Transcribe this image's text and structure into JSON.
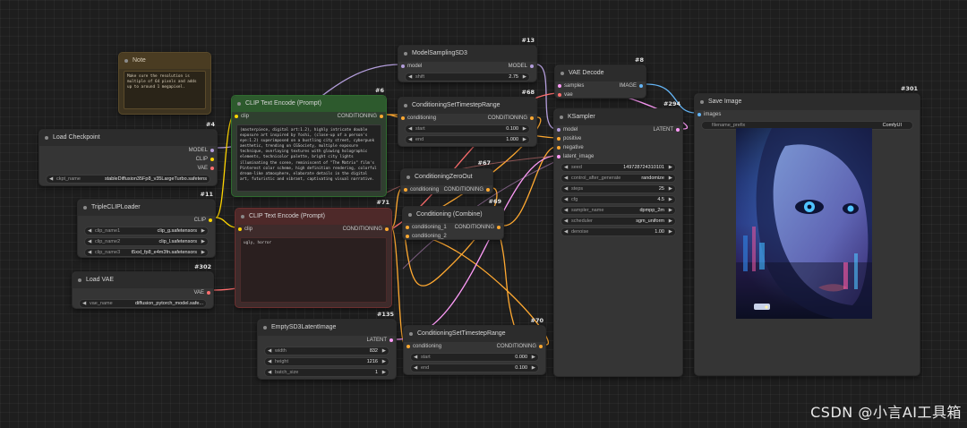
{
  "nodes": {
    "note": {
      "title": "Note",
      "text": "Make sure the resolution is multiple of 64 pixels and adds up to around 1 megapixel."
    },
    "clip_pos": {
      "id": "#6",
      "title": "CLIP Text Encode (Prompt)",
      "input": "clip",
      "output": "CONDITIONING",
      "text": "(masterpiece, digital art:1.2), highly intricate double exposure art inspired by Yoshi, (close-up of a person's eye:1.2) superimposed on a bustling city street, cyberpunk aesthetic, trending on CGSociety, multiple exposure technique, overlaying textures with glowing holographic elements, technicolor palette, bright city lights illuminating the scene, reminiscent of \"The Matrix\" film's Pinterest color scheme, high definition rendering, colorful dream-like atmosphere, elaborate details in the digital art, futuristic and vibrant, captivating visual narrative."
    },
    "clip_neg": {
      "id": "#71",
      "title": "CLIP Text Encode (Prompt)",
      "input": "clip",
      "output": "CONDITIONING",
      "text": "ugly, horror"
    },
    "model_sampling": {
      "id": "#13",
      "title": "ModelSamplingSD3",
      "input": "model",
      "output": "MODEL",
      "widget_label": "shift",
      "widget_value": "2.75"
    },
    "vae_decode": {
      "id": "#8",
      "title": "VAE Decode",
      "in1": "samples",
      "in2": "vae",
      "output": "IMAGE"
    },
    "save_image": {
      "id": "#301",
      "title": "Save Image",
      "input": "images",
      "widget_label": "filename_prefix",
      "widget_value": "ComfyUI"
    },
    "load_checkpoint": {
      "id": "#4",
      "title": "Load Checkpoint",
      "out1": "MODEL",
      "out2": "CLIP",
      "out3": "VAE",
      "widget_label": "ckpt_name",
      "widget_value": "stableDiffusion35Fp8_v35LargeTurbo.safetens"
    },
    "triple_clip": {
      "id": "#11",
      "title": "TripleCLIPLoader",
      "output": "CLIP",
      "w1_label": "clip_name1",
      "w1_value": "clip_g.safetensors",
      "w2_label": "clip_name2",
      "w2_value": "clip_l.safetensors",
      "w3_label": "clip_name3",
      "w3_value": "t5xxl_fp8_e4m3fn.safetensors"
    },
    "load_vae": {
      "id": "#302",
      "title": "Load VAE",
      "output": "VAE",
      "widget_label": "vae_name",
      "widget_value": "diffusion_pytorch_model.safe..."
    },
    "cond_ts1": {
      "id": "#68",
      "title": "ConditioningSetTimestepRange",
      "input": "conditioning",
      "output": "CONDITIONING",
      "w1_label": "start",
      "w1_value": "0.100",
      "w2_label": "end",
      "w2_value": "1.000"
    },
    "cond_zero": {
      "id": "#67",
      "title": "ConditioningZeroOut",
      "input": "conditioning",
      "output": "CONDITIONING"
    },
    "cond_combine": {
      "id": "#69",
      "title": "Conditioning (Combine)",
      "in1": "conditioning_1",
      "in2": "conditioning_2",
      "output": "CONDITIONING"
    },
    "cond_ts2": {
      "id": "#70",
      "title": "ConditioningSetTimestepRange",
      "input": "conditioning",
      "output": "CONDITIONING",
      "w1_label": "start",
      "w1_value": "0.000",
      "w2_label": "end",
      "w2_value": "0.100"
    },
    "empty_latent": {
      "id": "#135",
      "title": "EmptySD3LatentImage",
      "output": "LATENT",
      "w1_label": "width",
      "w1_value": "832",
      "w2_label": "height",
      "w2_value": "1216",
      "w3_label": "batch_size",
      "w3_value": "1"
    },
    "ksampler": {
      "id": "#294",
      "title": "KSampler",
      "in1": "model",
      "in2": "positive",
      "in3": "negative",
      "in4": "latent_image",
      "output": "LATENT",
      "w1_label": "seed",
      "w1_value": "149728724310101",
      "w2_label": "control_after_generate",
      "w2_value": "randomize",
      "w3_label": "steps",
      "w3_value": "25",
      "w4_label": "cfg",
      "w4_value": "4.5",
      "w5_label": "sampler_name",
      "w5_value": "dpmpp_2m",
      "w6_label": "scheduler",
      "w6_value": "sgm_uniform",
      "w7_label": "denoise",
      "w7_value": "1.00"
    }
  },
  "watermark": "CSDN @小言AI工具箱",
  "colors": {
    "model": "#b39ddb",
    "clip": "#ffd500",
    "vae": "#ff6e6e",
    "conditioning": "#ffa931",
    "latent": "#ff9cf9",
    "image": "#64b5f6"
  }
}
